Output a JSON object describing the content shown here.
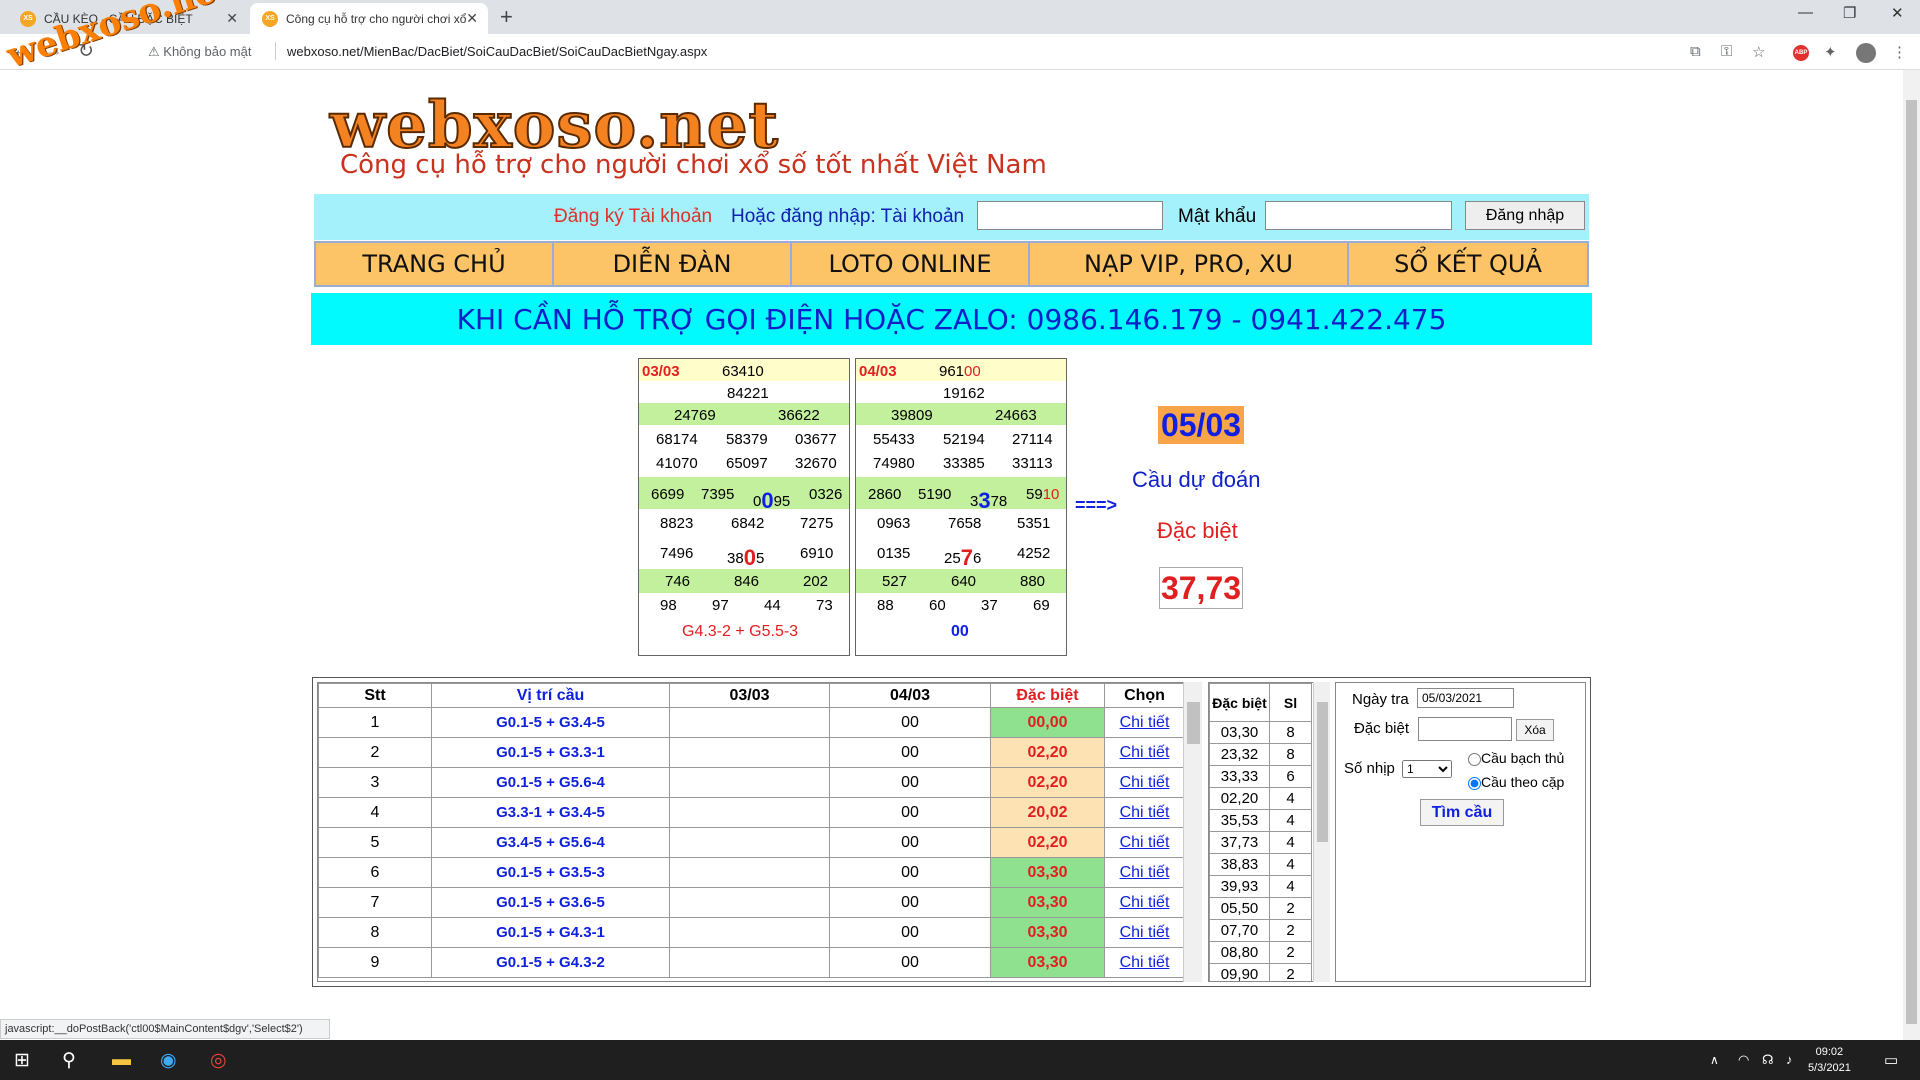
{
  "browser": {
    "tabs": [
      {
        "title": "CẦU KÈO - CẦU ĐẶC BIỆT",
        "favicon": "XS"
      },
      {
        "title": "Công cụ hỗ trợ cho người chơi xổ số",
        "favicon": "XS"
      }
    ],
    "security": "Không bảo mật",
    "url": "webxoso.net/MienBac/DacBiet/SoiCauDacBiet/SoiCauDacBietNgay.aspx",
    "abp": "ABP"
  },
  "watermark": "webxoso.net",
  "site": {
    "logo": "webxoso.net",
    "slogan": "Công cụ hỗ trợ cho người chơi xổ số tốt nhất Việt Nam"
  },
  "login": {
    "register": "Đăng ký Tài khoản",
    "or_login": "Hoặc đăng nhập: Tài khoản",
    "password_label": "Mật khẩu",
    "button": "Đăng nhập"
  },
  "menu": [
    "TRANG CHỦ",
    "DIỄN ĐÀN",
    "LOTO ONLINE",
    "NẠP VIP, PRO, XU",
    "SỔ KẾT QUẢ"
  ],
  "hotline": "KHI CẦN HỖ TRỢ GỌI ĐIỆN HOẶC ZALO: 0986.146.179 - 0941.422.475",
  "results": [
    {
      "date": "03/03",
      "g0": "63410",
      "g1": "84221",
      "g2": [
        "24769",
        "36622"
      ],
      "g3a": [
        "68174",
        "58379",
        "03677"
      ],
      "g3b": [
        "41070",
        "65097",
        "32670"
      ],
      "g4": [
        "6699",
        "7395",
        "0",
        "0",
        "95",
        "0326"
      ],
      "g5a": [
        "8823",
        "6842",
        "7275"
      ],
      "g5b": [
        "7496",
        "38",
        "0",
        "5",
        "6910"
      ],
      "g6": [
        "746",
        "846",
        "202"
      ],
      "g7": [
        "98",
        "97",
        "44",
        "73"
      ],
      "footer": "G4.3-2 + G5.5-3"
    },
    {
      "date": "04/03",
      "g0a": "961",
      "g0b": "00",
      "g1": "19162",
      "g2": [
        "39809",
        "24663"
      ],
      "g3a": [
        "55433",
        "52194",
        "27114"
      ],
      "g3b": [
        "74980",
        "33385",
        "33113"
      ],
      "g4": [
        "2860",
        "5190",
        "3",
        "3",
        "78",
        "59",
        "10"
      ],
      "g5a": [
        "0963",
        "7658",
        "5351"
      ],
      "g5b": [
        "0135",
        "25",
        "7",
        "6",
        "4252"
      ],
      "g6": [
        "527",
        "640",
        "880"
      ],
      "g7": [
        "88",
        "60",
        "37",
        "69"
      ],
      "footer": "00"
    }
  ],
  "prediction": {
    "arrow": "===>",
    "date": "05/03",
    "label": "Cầu dự đoán",
    "sublabel": "Đặc biệt",
    "value": "37,73"
  },
  "grid": {
    "headers": [
      "Stt",
      "Vị trí cầu",
      "03/03",
      "04/03",
      "Đặc biệt",
      "Chọn"
    ],
    "rows": [
      {
        "stt": "1",
        "pos": "G0.1-5 + G3.4-5",
        "d1": "",
        "d2": "00",
        "db": "00,00",
        "color": "#8fe08f",
        "link": "Chi tiết"
      },
      {
        "stt": "2",
        "pos": "G0.1-5 + G3.3-1",
        "d1": "",
        "d2": "00",
        "db": "02,20",
        "color": "#fde3b4",
        "link": "Chi tiết"
      },
      {
        "stt": "3",
        "pos": "G0.1-5 + G5.6-4",
        "d1": "",
        "d2": "00",
        "db": "02,20",
        "color": "#fde3b4",
        "link": "Chi tiết"
      },
      {
        "stt": "4",
        "pos": "G3.3-1 + G3.4-5",
        "d1": "",
        "d2": "00",
        "db": "20,02",
        "color": "#fde3b4",
        "link": "Chi tiết"
      },
      {
        "stt": "5",
        "pos": "G3.4-5 + G5.6-4",
        "d1": "",
        "d2": "00",
        "db": "02,20",
        "color": "#fde3b4",
        "link": "Chi tiết"
      },
      {
        "stt": "6",
        "pos": "G0.1-5 + G3.5-3",
        "d1": "",
        "d2": "00",
        "db": "03,30",
        "color": "#8fe08f",
        "link": "Chi tiết"
      },
      {
        "stt": "7",
        "pos": "G0.1-5 + G3.6-5",
        "d1": "",
        "d2": "00",
        "db": "03,30",
        "color": "#8fe08f",
        "link": "Chi tiết"
      },
      {
        "stt": "8",
        "pos": "G0.1-5 + G4.3-1",
        "d1": "",
        "d2": "00",
        "db": "03,30",
        "color": "#8fe08f",
        "link": "Chi tiết"
      },
      {
        "stt": "9",
        "pos": "G0.1-5 + G4.3-2",
        "d1": "",
        "d2": "00",
        "db": "03,30",
        "color": "#8fe08f",
        "link": "Chi tiết"
      }
    ]
  },
  "freq": {
    "headers": [
      "Đặc biệt",
      "Sl"
    ],
    "rows": [
      [
        "03,30",
        "8"
      ],
      [
        "23,32",
        "8"
      ],
      [
        "33,33",
        "6"
      ],
      [
        "02,20",
        "4"
      ],
      [
        "35,53",
        "4"
      ],
      [
        "37,73",
        "4"
      ],
      [
        "38,83",
        "4"
      ],
      [
        "39,93",
        "4"
      ],
      [
        "05,50",
        "2"
      ],
      [
        "07,70",
        "2"
      ],
      [
        "08,80",
        "2"
      ],
      [
        "09,90",
        "2"
      ]
    ]
  },
  "form": {
    "date_label": "Ngày tra",
    "date_value": "05/03/2021",
    "db_label": "Đặc biệt",
    "clear_button": "Xóa",
    "step_label": "Số nhịp",
    "step_value": "1",
    "radio1": "Cầu bạch thủ",
    "radio2": "Cầu theo cặp",
    "search_button": "Tìm cầu"
  },
  "status_bar": "javascript:__doPostBack('ctl00$MainContent$dgv','Select$2')",
  "clock": {
    "time": "09:02",
    "date": "5/3/2021"
  }
}
